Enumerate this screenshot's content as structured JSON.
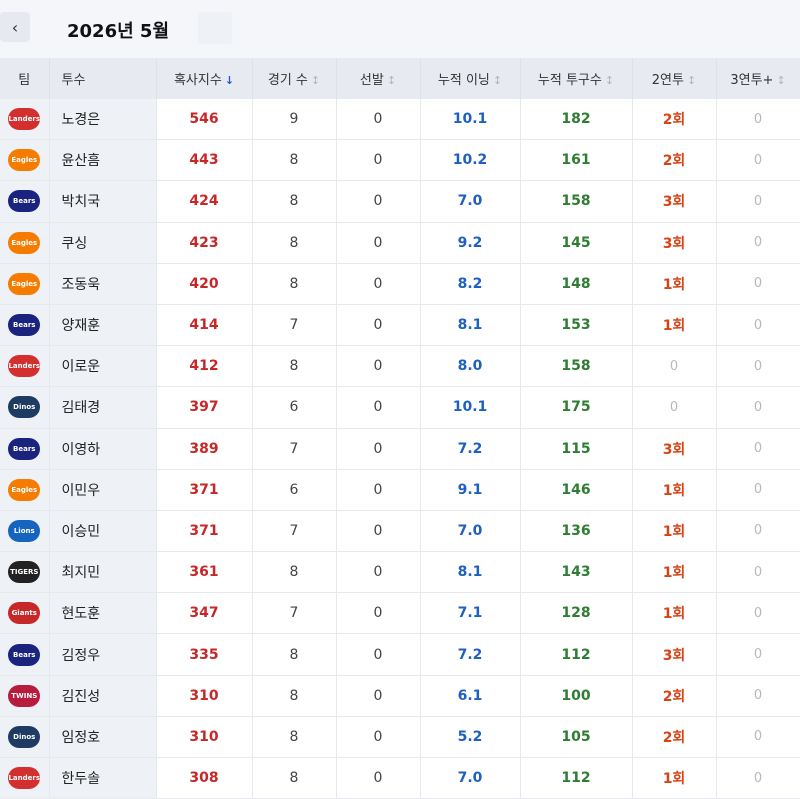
{
  "header": {
    "back_symbol": "‹",
    "month_title": "2026년 5월"
  },
  "columns": {
    "team": "팀",
    "pitcher": "투수",
    "score": "혹사지수",
    "games": "경기 수",
    "starts": "선발",
    "innings": "누적 이닝",
    "pitches": "누적 투구수",
    "two_consec": "2연투",
    "three_consec": "3연투+"
  },
  "sort_icons": {
    "active": "↓",
    "inactive": "↕"
  },
  "team_logos": {
    "landers": {
      "label": "Landers",
      "color": "#d32f2f"
    },
    "eagles": {
      "label": "Eagles",
      "color": "#f57c00"
    },
    "bears": {
      "label": "Bears",
      "color": "#1a237e"
    },
    "dinos": {
      "label": "Dinos",
      "color": "#1f3a63"
    },
    "lions": {
      "label": "Lions",
      "color": "#1565c0"
    },
    "tigers": {
      "label": "TIGERS",
      "color": "#222222"
    },
    "giants": {
      "label": "Giants",
      "color": "#c62828"
    },
    "twins": {
      "label": "TWINS",
      "color": "#b71c3c"
    }
  },
  "rows": [
    {
      "team": "landers",
      "name": "노경은",
      "score": "546",
      "games": "9",
      "starts": "0",
      "innings": "10.1",
      "pitches": "182",
      "two": "2회",
      "three": "0"
    },
    {
      "team": "eagles",
      "name": "윤산흠",
      "score": "443",
      "games": "8",
      "starts": "0",
      "innings": "10.2",
      "pitches": "161",
      "two": "2회",
      "three": "0"
    },
    {
      "team": "bears",
      "name": "박치국",
      "score": "424",
      "games": "8",
      "starts": "0",
      "innings": "7.0",
      "pitches": "158",
      "two": "3회",
      "three": "0"
    },
    {
      "team": "eagles",
      "name": "쿠싱",
      "score": "423",
      "games": "8",
      "starts": "0",
      "innings": "9.2",
      "pitches": "145",
      "two": "3회",
      "three": "0"
    },
    {
      "team": "eagles",
      "name": "조동욱",
      "score": "420",
      "games": "8",
      "starts": "0",
      "innings": "8.2",
      "pitches": "148",
      "two": "1회",
      "three": "0"
    },
    {
      "team": "bears",
      "name": "양재훈",
      "score": "414",
      "games": "7",
      "starts": "0",
      "innings": "8.1",
      "pitches": "153",
      "two": "1회",
      "three": "0"
    },
    {
      "team": "landers",
      "name": "이로운",
      "score": "412",
      "games": "8",
      "starts": "0",
      "innings": "8.0",
      "pitches": "158",
      "two": "0",
      "three": "0"
    },
    {
      "team": "dinos",
      "name": "김태경",
      "score": "397",
      "games": "6",
      "starts": "0",
      "innings": "10.1",
      "pitches": "175",
      "two": "0",
      "three": "0"
    },
    {
      "team": "bears",
      "name": "이영하",
      "score": "389",
      "games": "7",
      "starts": "0",
      "innings": "7.2",
      "pitches": "115",
      "two": "3회",
      "three": "0"
    },
    {
      "team": "eagles",
      "name": "이민우",
      "score": "371",
      "games": "6",
      "starts": "0",
      "innings": "9.1",
      "pitches": "146",
      "two": "1회",
      "three": "0"
    },
    {
      "team": "lions",
      "name": "이승민",
      "score": "371",
      "games": "7",
      "starts": "0",
      "innings": "7.0",
      "pitches": "136",
      "two": "1회",
      "three": "0"
    },
    {
      "team": "tigers",
      "name": "최지민",
      "score": "361",
      "games": "8",
      "starts": "0",
      "innings": "8.1",
      "pitches": "143",
      "two": "1회",
      "three": "0"
    },
    {
      "team": "giants",
      "name": "현도훈",
      "score": "347",
      "games": "7",
      "starts": "0",
      "innings": "7.1",
      "pitches": "128",
      "two": "1회",
      "three": "0"
    },
    {
      "team": "bears",
      "name": "김정우",
      "score": "335",
      "games": "8",
      "starts": "0",
      "innings": "7.2",
      "pitches": "112",
      "two": "3회",
      "three": "0"
    },
    {
      "team": "twins",
      "name": "김진성",
      "score": "310",
      "games": "8",
      "starts": "0",
      "innings": "6.1",
      "pitches": "100",
      "two": "2회",
      "three": "0"
    },
    {
      "team": "dinos",
      "name": "임정호",
      "score": "310",
      "games": "8",
      "starts": "0",
      "innings": "5.2",
      "pitches": "105",
      "two": "2회",
      "three": "0"
    },
    {
      "team": "landers",
      "name": "한두솔",
      "score": "308",
      "games": "8",
      "starts": "0",
      "innings": "7.0",
      "pitches": "112",
      "two": "1회",
      "three": "0"
    }
  ]
}
